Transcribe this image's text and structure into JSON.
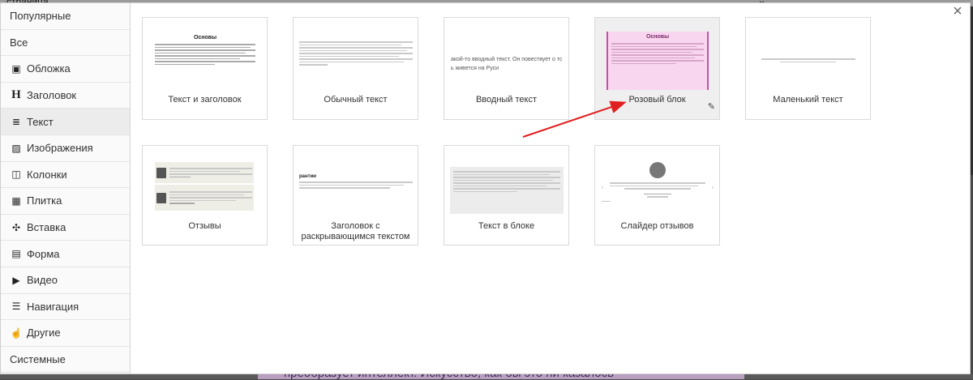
{
  "background": {
    "top_fragment": "страница",
    "bottom_fragment": "преобразует интеллект. Искусство, как бы это ни казалось"
  },
  "modal": {
    "close_glyph": "×"
  },
  "sidebar": {
    "items": [
      {
        "label": "Популярные",
        "icon": ""
      },
      {
        "label": "Все",
        "icon": ""
      },
      {
        "label": "Обложка",
        "icon": "cover-icon"
      },
      {
        "label": "Заголовок",
        "icon": "heading-icon"
      },
      {
        "label": "Текст",
        "icon": "text-icon",
        "active": true
      },
      {
        "label": "Изображения",
        "icon": "image-icon"
      },
      {
        "label": "Колонки",
        "icon": "columns-icon"
      },
      {
        "label": "Плитка",
        "icon": "tile-icon"
      },
      {
        "label": "Вставка",
        "icon": "embed-icon"
      },
      {
        "label": "Форма",
        "icon": "form-icon"
      },
      {
        "label": "Видео",
        "icon": "youtube-icon"
      },
      {
        "label": "Навигация",
        "icon": "menu-icon"
      },
      {
        "label": "Другие",
        "icon": "hand-icon"
      },
      {
        "label": "Системные",
        "icon": ""
      }
    ]
  },
  "cards": [
    {
      "caption": "Текст и заголовок",
      "preview_title": "Основы"
    },
    {
      "caption": "Обычный текст"
    },
    {
      "caption": "Вводный текст",
      "preview_text": "акой-то вводный текст. Он повествует о тс ь живется на Руси"
    },
    {
      "caption": "Розовый блок",
      "preview_title": "Основы",
      "highlighted": true
    },
    {
      "caption": "Маленький текст"
    },
    {
      "caption": "Отзывы"
    },
    {
      "caption": "Заголовок с раскрывающимся текстом",
      "preview_title": "рантии"
    },
    {
      "caption": "Текст в блоке"
    },
    {
      "caption": "Слайдер отзывов"
    }
  ],
  "colors": {
    "accent_arrow": "#e02020",
    "pink_block": "#f9d6f0",
    "pink_border": "#c54fa5",
    "active_item": "#ececec"
  }
}
